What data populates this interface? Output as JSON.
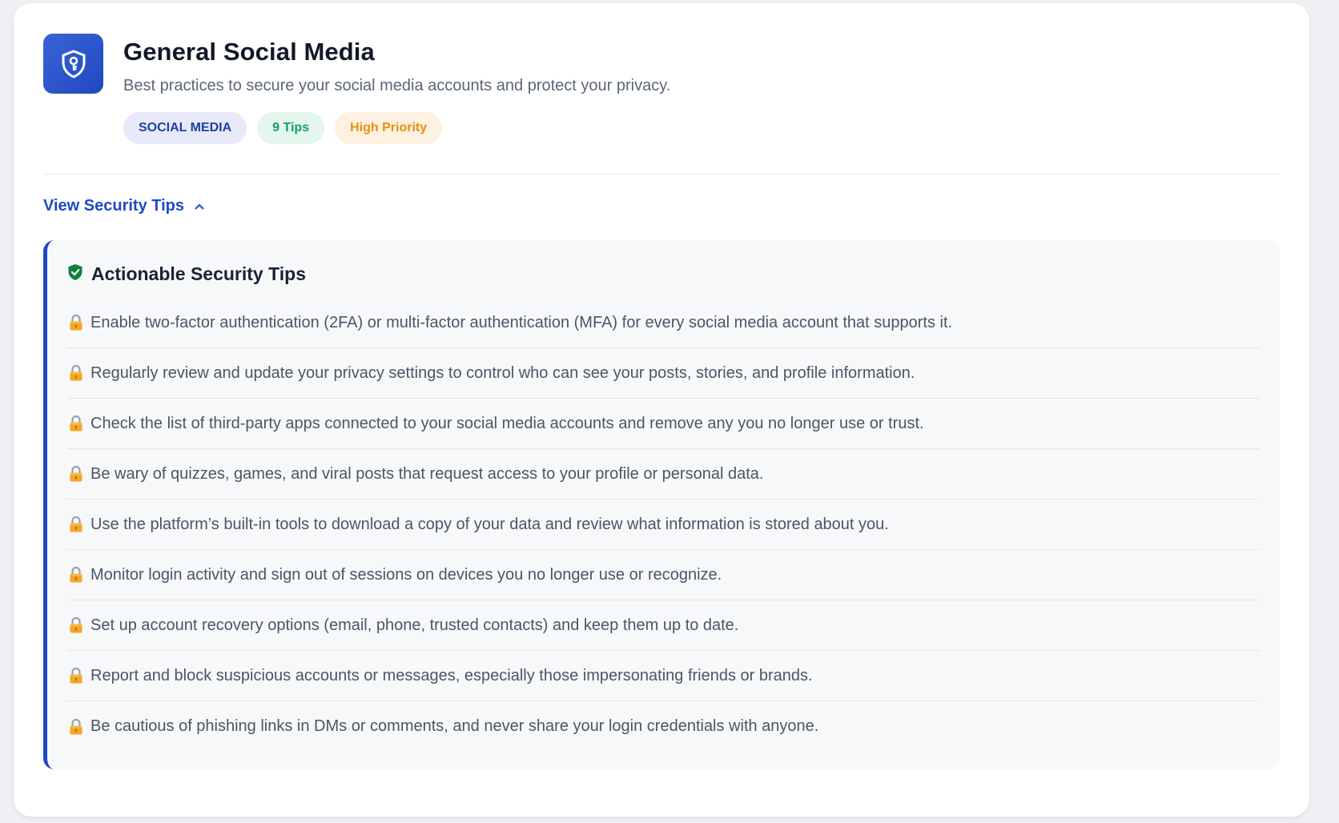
{
  "header": {
    "title": "General Social Media",
    "subtitle": "Best practices to secure your social media accounts and protect your privacy.",
    "icon": "shield-key-icon",
    "accent_color": "#1f49c2"
  },
  "badges": {
    "category": "SOCIAL MEDIA",
    "tips_count": "9 Tips",
    "priority": "High Priority"
  },
  "toggle": {
    "label": "View Security Tips",
    "expanded": true,
    "icon": "chevron-up-icon"
  },
  "tips_panel": {
    "heading": "Actionable Security Tips",
    "heading_icon": "shield-check-icon",
    "tip_icon": "lock-icon",
    "tips": [
      "Enable two-factor authentication (2FA) or multi-factor authentication (MFA) for every social media account that supports it.",
      "Regularly review and update your privacy settings to control who can see your posts, stories, and profile information.",
      "Check the list of third-party apps connected to your social media accounts and remove any you no longer use or trust.",
      "Be wary of quizzes, games, and viral posts that request access to your profile or personal data.",
      "Use the platform’s built-in tools to download a copy of your data and review what information is stored about you.",
      "Monitor login activity and sign out of sessions on devices you no longer use or recognize.",
      "Set up account recovery options (email, phone, trusted contacts) and keep them up to date.",
      "Report and block suspicious accounts or messages, especially those impersonating friends or brands.",
      "Be cautious of phishing links in DMs or comments, and never share your login credentials with anyone."
    ]
  }
}
